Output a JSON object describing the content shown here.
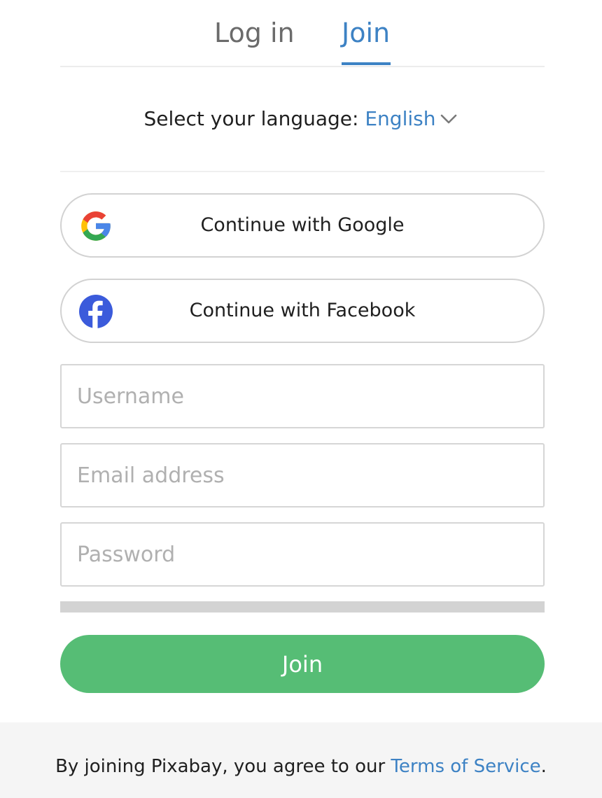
{
  "tabs": {
    "login_label": "Log in",
    "join_label": "Join",
    "active": "join"
  },
  "language": {
    "prompt": "Select your language:",
    "selected": "English"
  },
  "social": {
    "google_label": "Continue with Google",
    "facebook_label": "Continue with Facebook"
  },
  "form": {
    "username_placeholder": "Username",
    "username_value": "",
    "email_placeholder": "Email address",
    "email_value": "",
    "password_placeholder": "Password",
    "password_value": "",
    "password_strength": 0,
    "submit_label": "Join"
  },
  "footer": {
    "prefix": "By joining Pixabay, you agree to our",
    "terms_link": "Terms of Service",
    "suffix": "."
  },
  "colors": {
    "accent": "#3d82c4",
    "join_button": "#56bd75",
    "strength_bar": "#d3d3d3",
    "footer_bg": "#f5f5f5"
  },
  "icons": {
    "google": "google-logo-icon",
    "facebook": "facebook-logo-icon",
    "language_dropdown": "chevron-down-icon"
  }
}
